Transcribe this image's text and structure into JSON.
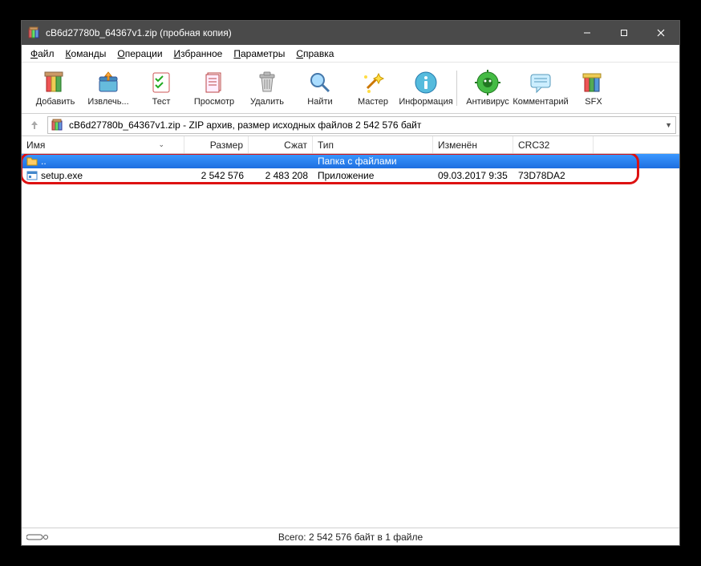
{
  "title": "cB6d27780b_64367v1.zip (пробная копия)",
  "menu": {
    "file": {
      "label": "Файл",
      "ul": "Ф"
    },
    "cmds": {
      "label": "Команды",
      "ul": "К"
    },
    "ops": {
      "label": "Операции",
      "ul": "О"
    },
    "fav": {
      "label": "Избранное",
      "ul": "И"
    },
    "params": {
      "label": "Параметры",
      "ul": "П"
    },
    "help": {
      "label": "Справка",
      "ul": "С"
    }
  },
  "toolbar": {
    "add": "Добавить",
    "extract": "Извлечь...",
    "test": "Тест",
    "view": "Просмотр",
    "delete": "Удалить",
    "find": "Найти",
    "wizard": "Мастер",
    "info": "Информация",
    "antivirus": "Антивирус",
    "comment": "Комментарий",
    "sfx": "SFX"
  },
  "address": "cB6d27780b_64367v1.zip - ZIP архив, размер исходных файлов 2 542 576 байт",
  "columns": {
    "name": "Имя",
    "size": "Размер",
    "packed": "Сжат",
    "type": "Тип",
    "modified": "Изменён",
    "crc": "CRC32"
  },
  "rows": {
    "parent": {
      "name": "..",
      "type": "Папка с файлами"
    },
    "r1": {
      "name": "setup.exe",
      "size": "2 542 576",
      "packed": "2 483 208",
      "type": "Приложение",
      "modified": "09.03.2017 9:35",
      "crc": "73D78DA2"
    }
  },
  "status": {
    "summary": "Всего: 2 542 576 байт в 1 файле"
  }
}
